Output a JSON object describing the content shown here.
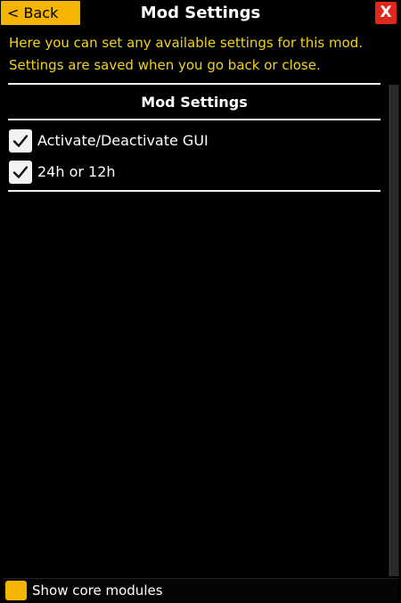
{
  "header": {
    "back_label": "< Back",
    "title": "Mod Settings",
    "close_label": "X"
  },
  "description": {
    "line1": "Here you can set any available settings for this mod.",
    "line2": "Settings are saved when you go back or close."
  },
  "section": {
    "heading": "Mod Settings"
  },
  "settings": [
    {
      "label": "Activate/Deactivate GUI",
      "checked": true
    },
    {
      "label": "24h or 12h",
      "checked": true
    }
  ],
  "footer": {
    "show_core_label": "Show core modules",
    "show_core_checked": false
  },
  "colors": {
    "accent": "#f4b400",
    "close": "#e1281c",
    "description_text": "#f2d31b",
    "background": "#000000"
  },
  "icons": {
    "checkmark": "checkmark-icon"
  }
}
